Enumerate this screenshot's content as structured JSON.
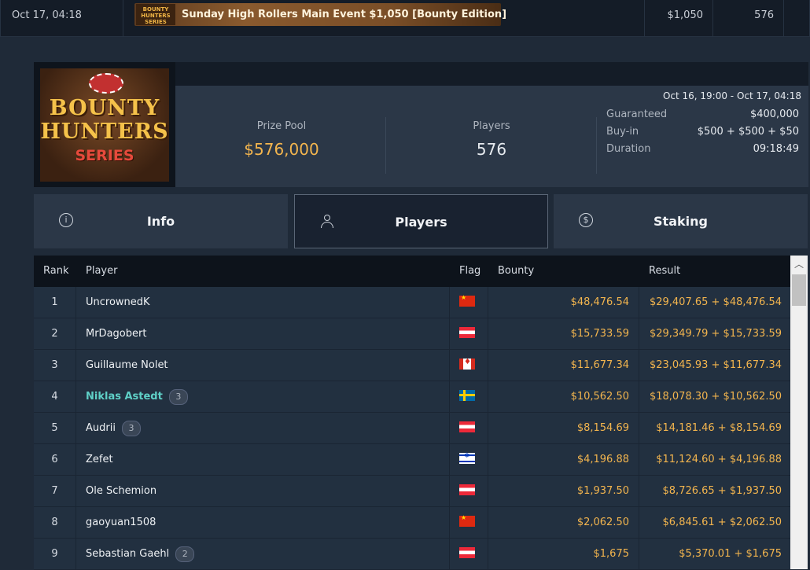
{
  "top_row": {
    "date": "Oct 17, 04:18",
    "banner_logo_text": "BOUNTY HUNTERS SERIES",
    "tournament_name": "Sunday High Rollers Main Event $1,050 [Bounty Edition]",
    "buyin": "$1,050",
    "entries": "576"
  },
  "header": {
    "logo_line1": "BOUNTY",
    "logo_line2": "HUNTERS",
    "logo_line3": "SERIES",
    "date_range": "Oct 16, 19:00 - Oct 17, 04:18",
    "prize_pool_label": "Prize Pool",
    "prize_pool_value": "$576,000",
    "players_label": "Players",
    "players_value": "576",
    "details": [
      {
        "label": "Guaranteed",
        "value": "$400,000"
      },
      {
        "label": "Buy-in",
        "value": "$500 + $500 + $50"
      },
      {
        "label": "Duration",
        "value": "09:18:49"
      }
    ]
  },
  "tabs": [
    {
      "label": "Info",
      "icon": "info-icon",
      "active": false
    },
    {
      "label": "Players",
      "icon": "user-icon",
      "active": true
    },
    {
      "label": "Staking",
      "icon": "dollar-icon",
      "active": false
    }
  ],
  "table": {
    "columns": {
      "rank": "Rank",
      "player": "Player",
      "flag": "Flag",
      "bounty": "Bounty",
      "result": "Result"
    },
    "rows": [
      {
        "rank": "1",
        "player": "UncrownedK",
        "badge": "",
        "flag": "cn",
        "bounty": "$48,476.54",
        "result": "$29,407.65 + $48,476.54"
      },
      {
        "rank": "2",
        "player": "MrDagobert",
        "badge": "",
        "flag": "at",
        "bounty": "$15,733.59",
        "result": "$29,349.79 + $15,733.59"
      },
      {
        "rank": "3",
        "player": "Guillaume Nolet",
        "badge": "",
        "flag": "ca",
        "bounty": "$11,677.34",
        "result": "$23,045.93 + $11,677.34"
      },
      {
        "rank": "4",
        "player": "Niklas Astedt",
        "badge": "3",
        "flag": "se",
        "bounty": "$10,562.50",
        "result": "$18,078.30 + $10,562.50",
        "highlight": true
      },
      {
        "rank": "5",
        "player": "Audrii",
        "badge": "3",
        "flag": "at",
        "bounty": "$8,154.69",
        "result": "$14,181.46 + $8,154.69"
      },
      {
        "rank": "6",
        "player": "Zefet",
        "badge": "",
        "flag": "il",
        "bounty": "$4,196.88",
        "result": "$11,124.60 + $4,196.88"
      },
      {
        "rank": "7",
        "player": "Ole Schemion",
        "badge": "",
        "flag": "at",
        "bounty": "$1,937.50",
        "result": "$8,726.65 + $1,937.50"
      },
      {
        "rank": "8",
        "player": "gaoyuan1508",
        "badge": "",
        "flag": "cn",
        "bounty": "$2,062.50",
        "result": "$6,845.61 + $2,062.50"
      },
      {
        "rank": "9",
        "player": "Sebastian Gaehl",
        "badge": "2",
        "flag": "at",
        "bounty": "$1,675",
        "result": "$5,370.01 + $1,675"
      }
    ]
  },
  "colors": {
    "accent_gold": "#f3b54e",
    "highlight_teal": "#5fd0c7"
  }
}
